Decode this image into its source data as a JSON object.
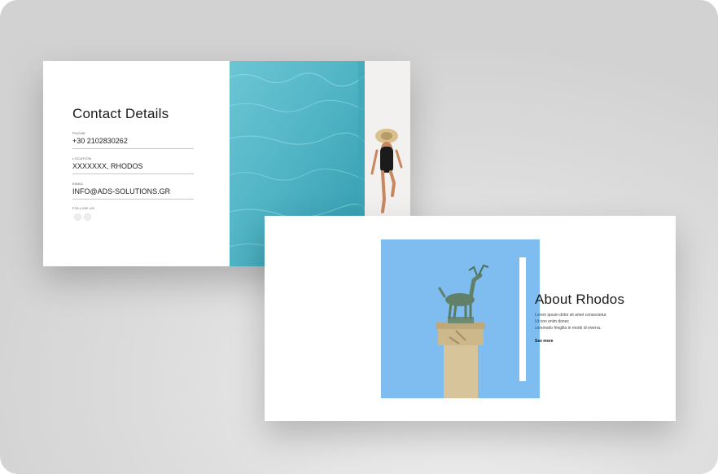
{
  "contact_card": {
    "title": "Contact Details",
    "fields": [
      {
        "label": "PHONE",
        "value": "+30 2102830262"
      },
      {
        "label": "LOCATION",
        "value": "XXXXXXX, RHODOS"
      },
      {
        "label": "EMAIL",
        "value": "INFO@ADS-SOLUTIONS.GR"
      }
    ],
    "follow_label": "FOLLOW US",
    "social_icons": [
      "social-icon-1",
      "social-icon-2"
    ]
  },
  "about_card": {
    "title": "About Rhodos",
    "body_lines": [
      "Lorem ipsum dolor sit amet consectetur.",
      "Ut non enim donec",
      "commodo fringilla in morbi id viverra."
    ],
    "link_label": "See more"
  },
  "colors": {
    "background": "#dcdcdc",
    "card": "#ffffff",
    "pool": "#4fb3c4",
    "sky": "#7fbdf0",
    "text": "#1b1b1b"
  }
}
